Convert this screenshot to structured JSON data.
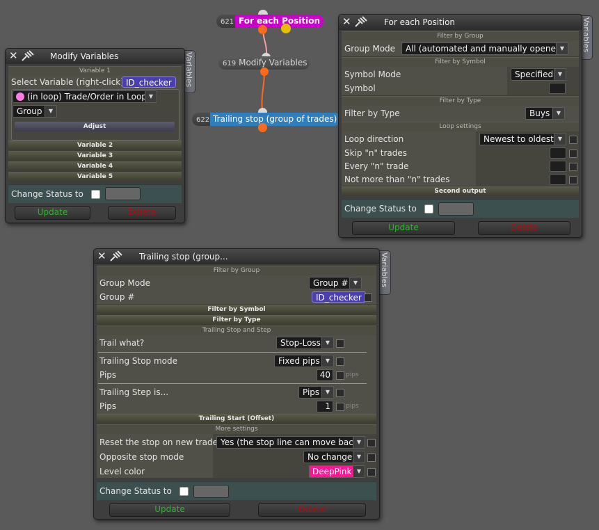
{
  "graph": {
    "nodes": [
      {
        "id": "621",
        "label": "For each Position"
      },
      {
        "id": "619",
        "label": "Modify Variables"
      },
      {
        "id": "622",
        "label": "Trailing stop (group of trades)"
      }
    ]
  },
  "modify_panel": {
    "title": "Modify Variables",
    "vtab": "Variables",
    "section_variable1": "Variable 1",
    "select_label": "Select Variable (right-click)",
    "select_value": "ID_checker",
    "target_dropdown": "(in loop) Trade/Order in Loop",
    "group_dropdown": "Group",
    "adjust_label": "Adjust",
    "variables": [
      "Variable 2",
      "Variable 3",
      "Variable 4",
      "Variable 5"
    ],
    "change_status_label": "Change Status to",
    "update_label": "Update",
    "delete_label": "Delete"
  },
  "foreach_panel": {
    "title": "For each Position",
    "vtab": "Variables",
    "section_filter_group": "Filter by Group",
    "group_mode_label": "Group Mode",
    "group_mode_value": "All (automated and manually opened)",
    "section_filter_symbol": "Filter by Symbol",
    "symbol_mode_label": "Symbol Mode",
    "symbol_mode_value": "Specified",
    "symbol_label": "Symbol",
    "section_filter_type": "Filter by Type",
    "filter_type_label": "Filter by Type",
    "filter_type_value": "Buys",
    "section_loop": "Loop settings",
    "loop_direction_label": "Loop direction",
    "loop_direction_value": "Newest to oldest",
    "skip_label": "Skip \"n\" trades",
    "every_label": "Every \"n\" trade",
    "notmore_label": "Not more than \"n\" trades",
    "section_second_output": "Second output",
    "change_status_label": "Change Status to",
    "update_label": "Update",
    "delete_label": "Delete"
  },
  "trailing_panel": {
    "title": "Trailing stop (group...",
    "vtab": "Variables",
    "section_filter_group": "Filter by Group",
    "group_mode_label": "Group Mode",
    "group_mode_value": "Group #",
    "group_num_label": "Group #",
    "group_num_value": "ID_checker",
    "section_filter_symbol": "Filter by Symbol",
    "section_filter_type": "Filter by Type",
    "section_trailing": "Trailing Stop and Step",
    "trail_what_label": "Trail what?",
    "trail_what_value": "Stop-Loss",
    "ts_mode_label": "Trailing Stop mode",
    "ts_mode_value": "Fixed pips",
    "pips_label": "Pips",
    "pips_value": "40",
    "pips_unit": "pips",
    "step_label": "Trailing Step is...",
    "step_value": "Pips",
    "step_pips_label": "Pips",
    "step_pips_value": "1",
    "step_pips_unit": "pips",
    "section_trailing_start": "Trailing Start (Offset)",
    "section_more": "More settings",
    "reset_label": "Reset the stop on new trade",
    "reset_value": "Yes (the stop line can move back)",
    "opposite_label": "Opposite stop mode",
    "opposite_value": "No change",
    "level_color_label": "Level color",
    "level_color_value": "DeepPink",
    "change_status_label": "Change Status to",
    "update_label": "Update",
    "delete_label": "Delete"
  },
  "colors": {
    "for_each_node": "#cc00cc",
    "modify_node": "#555555",
    "trailing_node": "#2f7fc0",
    "connector": "#ff6a1a",
    "deep_pink": "#ff1493",
    "variable_pill": "#4a3fb0",
    "update_text": "#2bb52b",
    "delete_text": "#b00d0d",
    "status_bg": "#3c5050"
  }
}
